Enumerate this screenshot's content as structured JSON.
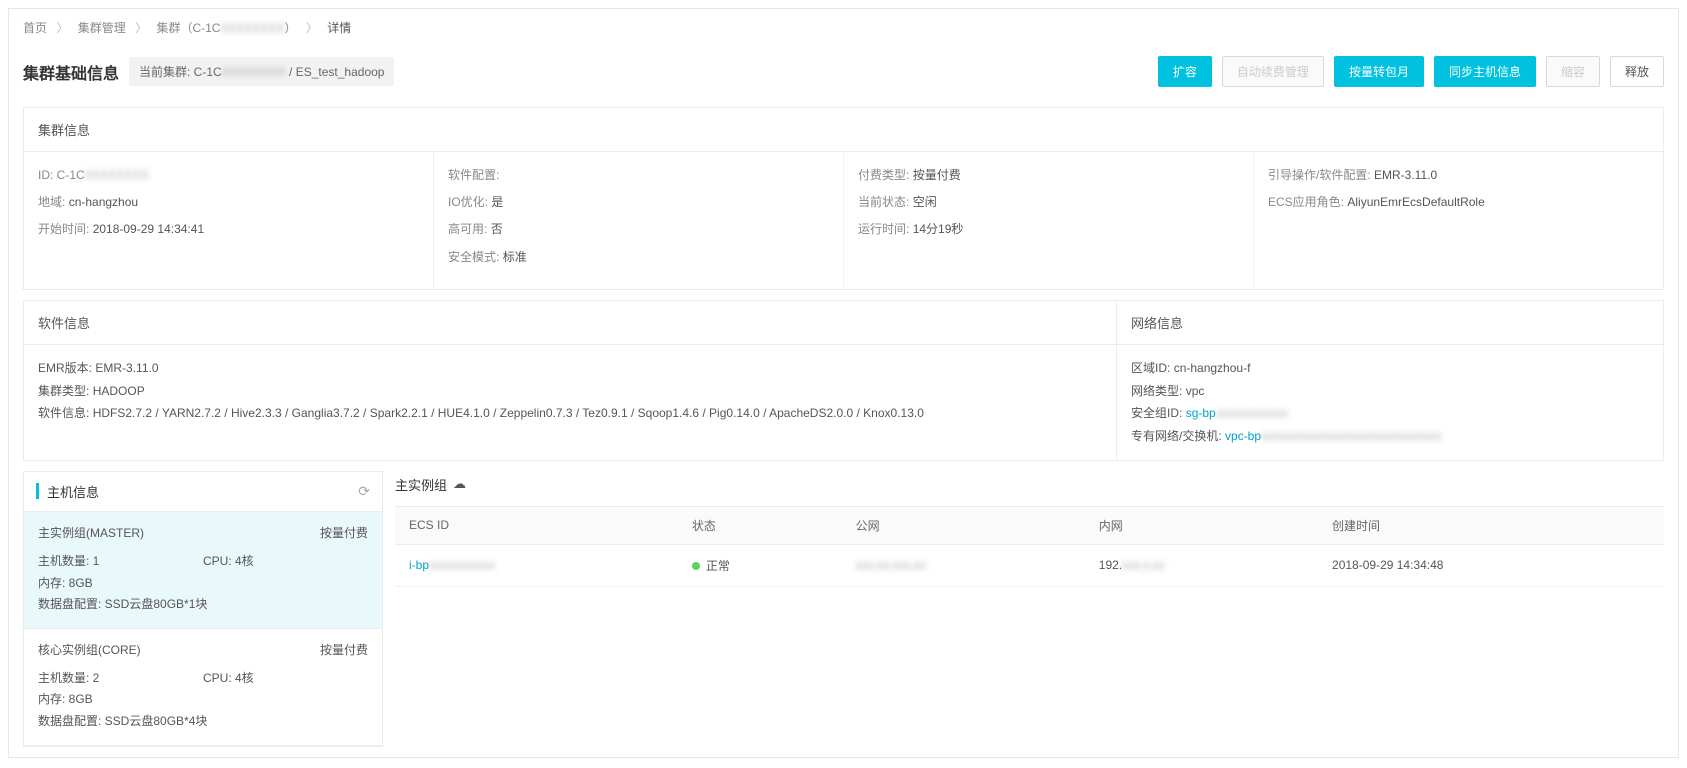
{
  "breadcrumb": {
    "home": "首页",
    "mgmt": "集群管理",
    "cluster_prefix": "集群（C-1C",
    "cluster_blur": "XXXXXXXX",
    "cluster_suffix": "）",
    "detail": "详情"
  },
  "header": {
    "title": "集群基础信息",
    "chip_prefix": "当前集群: C-1C",
    "chip_blur": "XXXXXXXX",
    "chip_suffix": " / ES_test_hadoop",
    "buttons": {
      "scale": "扩容",
      "auto_renew": "自动续费管理",
      "to_monthly": "按量转包月",
      "sync_host": "同步主机信息",
      "shrink": "缩容",
      "release": "释放"
    }
  },
  "cluster_info": {
    "title": "集群信息",
    "col1": {
      "id_label": "ID: C-1C",
      "id_blur": "XXXXXXXX",
      "region_label": "地域:",
      "region_value": "cn-hangzhou",
      "start_label": "开始时间:",
      "start_value": "2018-09-29 14:34:41"
    },
    "col2": {
      "sw_label": "软件配置:",
      "sw_value": "",
      "io_label": "IO优化:",
      "io_value": "是",
      "ha_label": "高可用:",
      "ha_value": "否",
      "sec_label": "安全模式:",
      "sec_value": "标准"
    },
    "col3": {
      "pay_label": "付费类型:",
      "pay_value": "按量付费",
      "status_label": "当前状态:",
      "status_value": "空闲",
      "runtime_label": "运行时间:",
      "runtime_value": "14分19秒"
    },
    "col4": {
      "boot_label": "引导操作/软件配置:",
      "boot_value": "EMR-3.11.0",
      "ecs_role_label": "ECS应用角色:",
      "ecs_role_value": "AliyunEmrEcsDefaultRole"
    }
  },
  "software_info": {
    "title": "软件信息",
    "emr_label": "EMR版本:",
    "emr_value": "EMR-3.11.0",
    "type_label": "集群类型:",
    "type_value": "HADOOP",
    "stack_label": "软件信息:",
    "stack_value": "HDFS2.7.2 / YARN2.7.2 / Hive2.3.3 / Ganglia3.7.2 / Spark2.2.1 / HUE4.1.0 / Zeppelin0.7.3 / Tez0.9.1 / Sqoop1.4.6 / Pig0.14.0 / ApacheDS2.0.0 / Knox0.13.0"
  },
  "network_info": {
    "title": "网络信息",
    "zone_label": "区域ID:",
    "zone_value": "cn-hangzhou-f",
    "net_label": "网络类型:",
    "net_value": "vpc",
    "sg_label": "安全组ID:",
    "sg_link": "sg-bp",
    "sg_blur": "xxxxxxxxxxxx",
    "vpc_label": "专有网络/交换机:",
    "vpc_link": "vpc-bp",
    "vpc_blur": "xxxxxxxxxxxxxxxxxxxxxxxxxxxxxx"
  },
  "host_sidebar": {
    "title": "主机信息",
    "groups": [
      {
        "name": "主实例组(MASTER)",
        "pay": "按量付费",
        "hosts": "主机数量: 1",
        "cpu": "CPU: 4核",
        "mem": "内存: 8GB",
        "disk": "数据盘配置: SSD云盘80GB*1块",
        "selected": true
      },
      {
        "name": "核心实例组(CORE)",
        "pay": "按量付费",
        "hosts": "主机数量: 2",
        "cpu": "CPU: 4核",
        "mem": "内存: 8GB",
        "disk": "数据盘配置: SSD云盘80GB*4块",
        "selected": false
      }
    ]
  },
  "host_table": {
    "title": "主实例组",
    "headers": {
      "ecs": "ECS ID",
      "status": "状态",
      "public": "公网",
      "private": "内网",
      "created": "创建时间"
    },
    "row": {
      "ecs_prefix": "i-bp",
      "ecs_blur": "xxxxxxxxxxx",
      "status": "正常",
      "public_blur": "xxx.xx.xxx.xx",
      "private": "192.",
      "private_blur": "xxx.x.xx",
      "created": "2018-09-29 14:34:48"
    }
  }
}
